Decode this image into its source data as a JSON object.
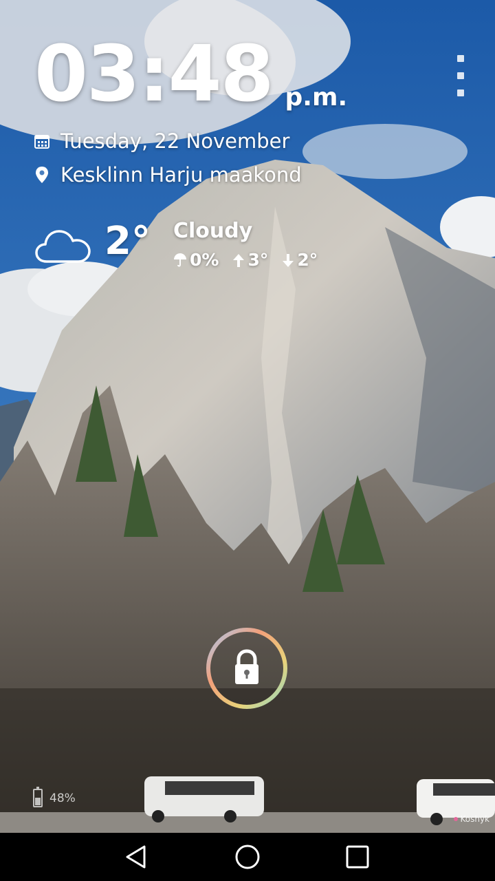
{
  "lockscreen": {
    "time": "03:48",
    "ampm": "p.m.",
    "date": "Tuesday, 22 November",
    "location": "Kesklinn Harju maakond",
    "weather": {
      "icon": "cloud-icon",
      "temperature": "2°",
      "condition": "Cloudy",
      "precipitation": "0%",
      "high": "3°",
      "low": "2°"
    },
    "unlock_icon": "lock-icon",
    "menu_icon": "overflow-menu-icon"
  },
  "status": {
    "battery_percent_label": "48%",
    "battery_level": 0.48
  },
  "watermark": "Koshyk",
  "navigation": {
    "back_icon": "back-icon",
    "home_icon": "home-icon",
    "recents_icon": "recents-icon"
  },
  "colors": {
    "sky": "#2a6fb8",
    "navbar": "#000000",
    "ring_gradient": [
      "#f3a07a",
      "#e9d37a",
      "#8fd7c6",
      "#a9c9ef"
    ]
  }
}
